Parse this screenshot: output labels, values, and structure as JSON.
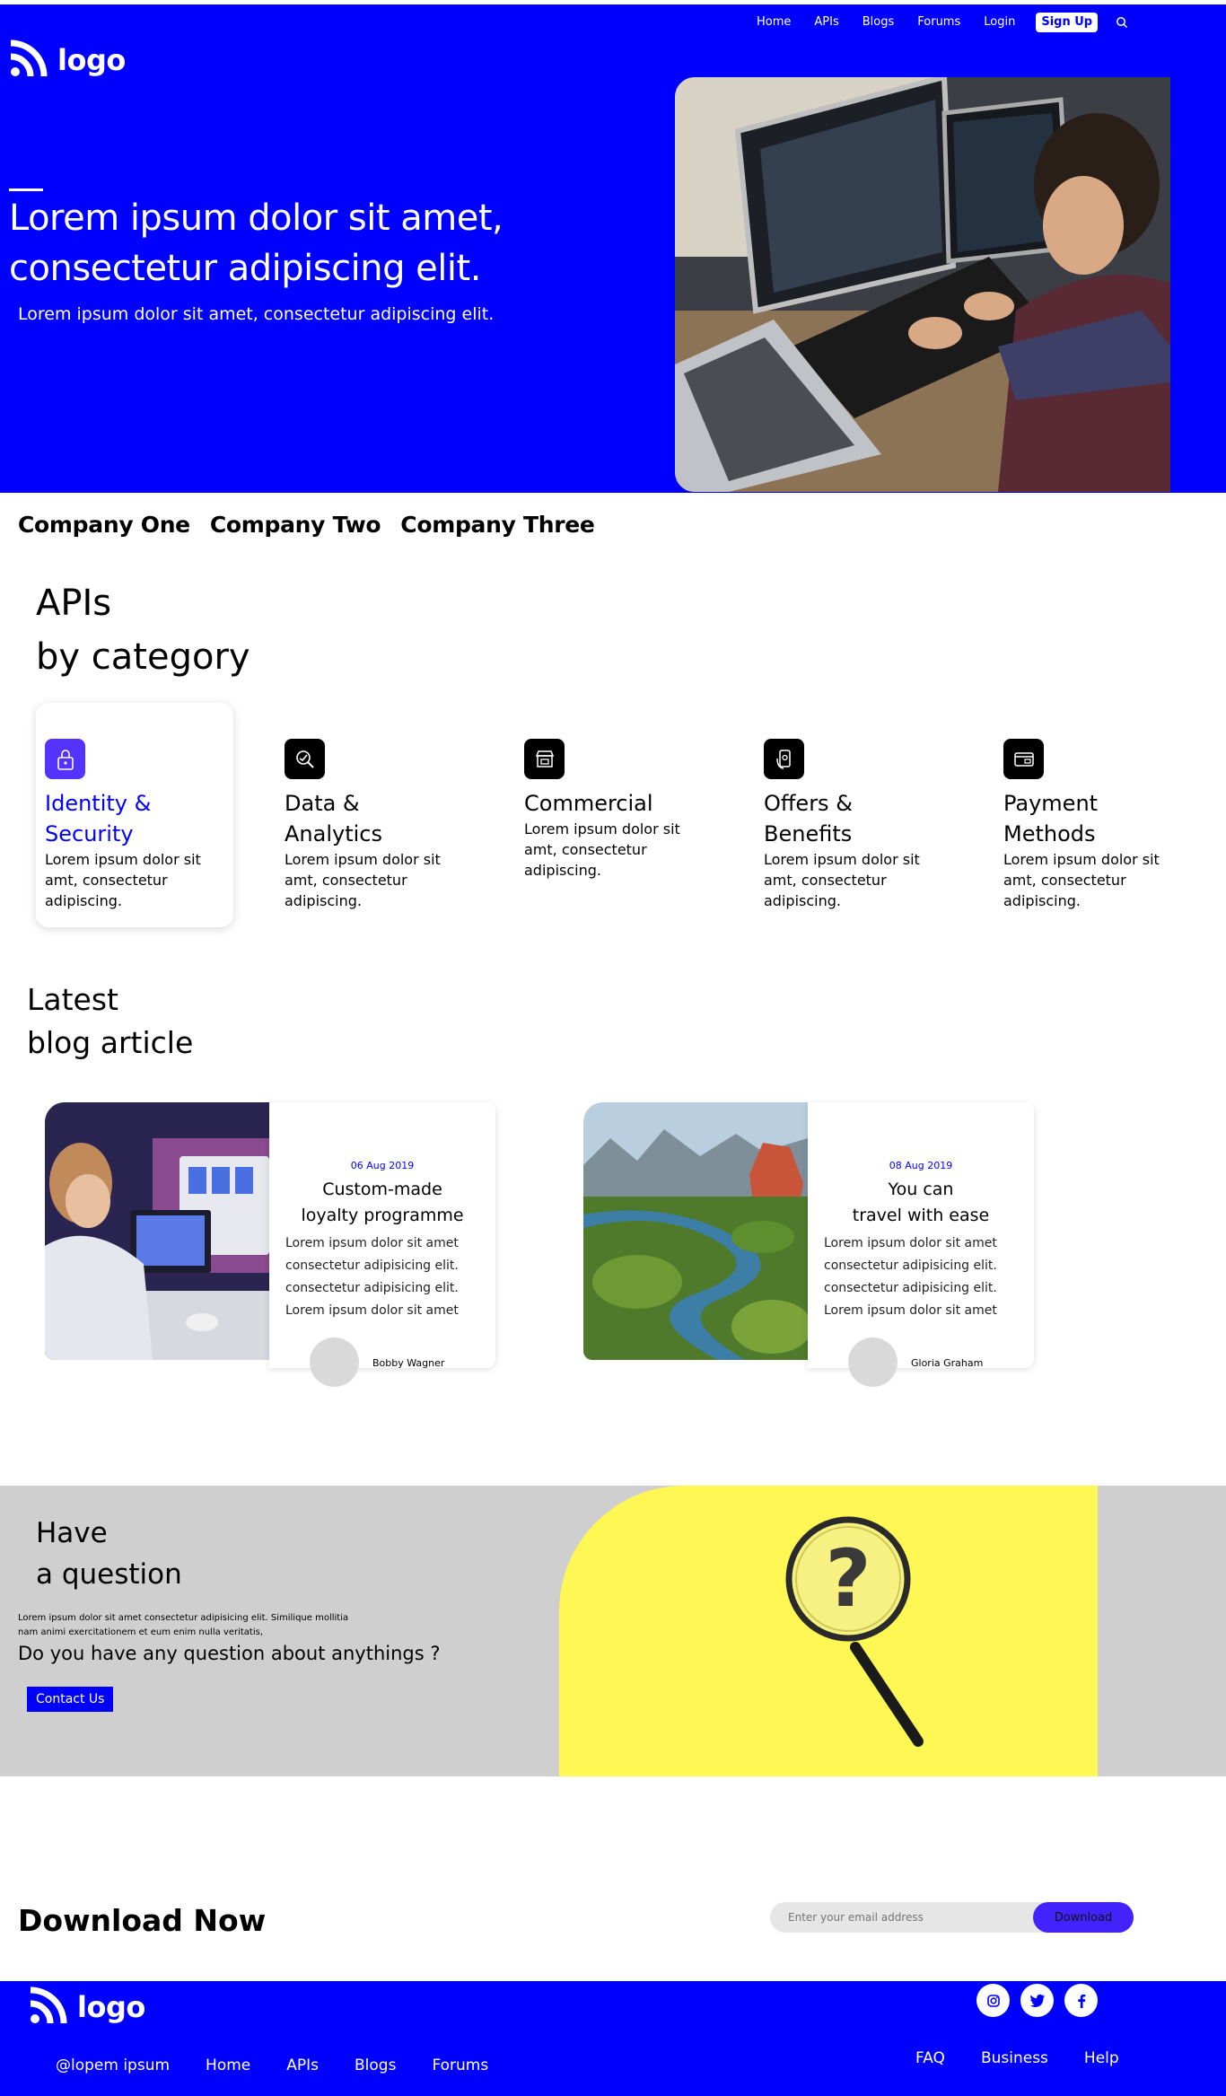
{
  "nav": {
    "items": [
      "Home",
      "APIs",
      "Blogs",
      "Forums",
      "Login"
    ],
    "signup": "Sign Up",
    "search_icon": "search-icon"
  },
  "logo": {
    "text": "logo",
    "icon": "rss-icon"
  },
  "hero": {
    "title_line1": "Lorem ipsum dolor sit amet,",
    "title_line2": "consectetur adipiscing elit.",
    "subtitle": "Lorem ipsum dolor sit amet, consectetur adipiscing elit."
  },
  "companies": [
    "Company One",
    "Company Two",
    "Company Three"
  ],
  "apis": {
    "title_line1": "APIs",
    "title_line2": "by category",
    "categories": [
      {
        "name_line1": "Identity &",
        "name_line2": "Security",
        "desc": "Lorem ipsum dolor sit amt, consectetur adipiscing.",
        "icon": "lock-icon"
      },
      {
        "name_line1": "Data &",
        "name_line2": "Analytics",
        "desc": "Lorem ipsum dolor sit amt, consectetur adipiscing.",
        "icon": "analytics-icon"
      },
      {
        "name_line1": "Commercial",
        "name_line2": "",
        "desc": "Lorem ipsum dolor sit amt, consectetur adipiscing.",
        "icon": "store-icon"
      },
      {
        "name_line1": "Offers &",
        "name_line2": "Benefits",
        "desc": "Lorem ipsum dolor sit amt, consectetur adipiscing.",
        "icon": "offer-icon"
      },
      {
        "name_line1": "Payment",
        "name_line2": "Methods",
        "desc": "Lorem ipsum dolor sit amt, consectetur adipiscing.",
        "icon": "card-icon"
      }
    ]
  },
  "blog": {
    "title_line1": "Latest",
    "title_line2": "blog article",
    "articles": [
      {
        "date": "06 Aug 2019",
        "title_line1": "Custom-made",
        "title_line2": "loyalty programme",
        "lines": [
          "Lorem ipsum dolor sit amet",
          "consectetur adipisicing elit.",
          "consectetur adipisicing elit.",
          "Lorem ipsum dolor sit amet"
        ],
        "author": "Bobby Wagner"
      },
      {
        "date": "08 Aug 2019",
        "title_line1": "You can",
        "title_line2": "travel with ease",
        "lines": [
          "Lorem ipsum dolor sit amet",
          "consectetur adipisicing elit.",
          "consectetur adipisicing elit.",
          "Lorem ipsum dolor sit amet"
        ],
        "author": "Gloria Graham"
      }
    ]
  },
  "question": {
    "title_line1": "Have",
    "title_line2": "a question",
    "text_line1": "Lorem ipsum dolor sit amet consectetur adipisicing elit. Similique mollitia",
    "text_line2": "nam animi exercitationem et eum enim nulla veritatis,",
    "ask": "Do you have any question about anythings ?",
    "button": "Contact Us"
  },
  "download": {
    "title_bold": "Download",
    "title_rest": " Now",
    "placeholder": "Enter your email address",
    "button": "Download"
  },
  "footer": {
    "handle": "@lopem ipsum",
    "links": [
      "Home",
      "APIs",
      "Blogs",
      "Forums"
    ],
    "right_links": [
      "FAQ",
      "Business",
      "Help"
    ],
    "social": [
      "instagram-icon",
      "twitter-icon",
      "facebook-icon"
    ]
  },
  "colors": {
    "brand_blue": "#0000ff",
    "accent_violet": "#4422ff",
    "yellow": "#fff754",
    "grey_band": "#cfcfcf"
  }
}
